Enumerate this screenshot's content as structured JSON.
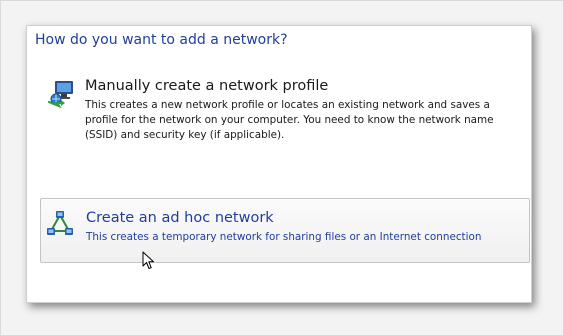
{
  "dialog": {
    "heading": "How do you want to add a network?"
  },
  "options": [
    {
      "title": "Manually create a network profile",
      "description": "This creates a new network profile or locates an existing network and saves a profile for the network on your computer. You need to know the network name (SSID) and security key (if applicable).",
      "icon": "network-computer-icon"
    },
    {
      "title": "Create an ad hoc network",
      "description": "This creates a temporary network for sharing files or an Internet connection",
      "icon": "adhoc-network-icon"
    }
  ],
  "colors": {
    "heading": "#1f3f9a",
    "hover_border": "#c4c4c4"
  }
}
